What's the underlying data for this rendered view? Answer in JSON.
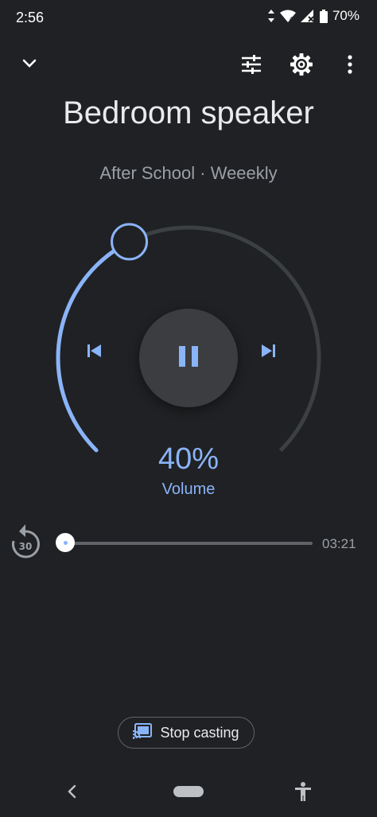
{
  "status_bar": {
    "time": "2:56",
    "battery": "70%"
  },
  "top_bar": {
    "collapse_icon": "chevron-down-icon",
    "equalizer_icon": "tune-icon",
    "settings_icon": "gear-icon",
    "more_icon": "more-vert-icon"
  },
  "device": {
    "name": "Bedroom speaker"
  },
  "media": {
    "subtitle": "After School · Weeekly"
  },
  "volume": {
    "percent_text": "40%",
    "label": "Volume",
    "level": 0.4
  },
  "controls": {
    "previous_icon": "skip-previous-icon",
    "pause_icon": "pause-icon",
    "next_icon": "skip-next-icon"
  },
  "progress": {
    "replay_seconds": "30",
    "remaining": "03:21",
    "position": 0.0
  },
  "cast": {
    "stop_label": "Stop casting"
  },
  "colors": {
    "accent": "#8ab4f8",
    "background": "#202124",
    "track": "#5f6368"
  }
}
